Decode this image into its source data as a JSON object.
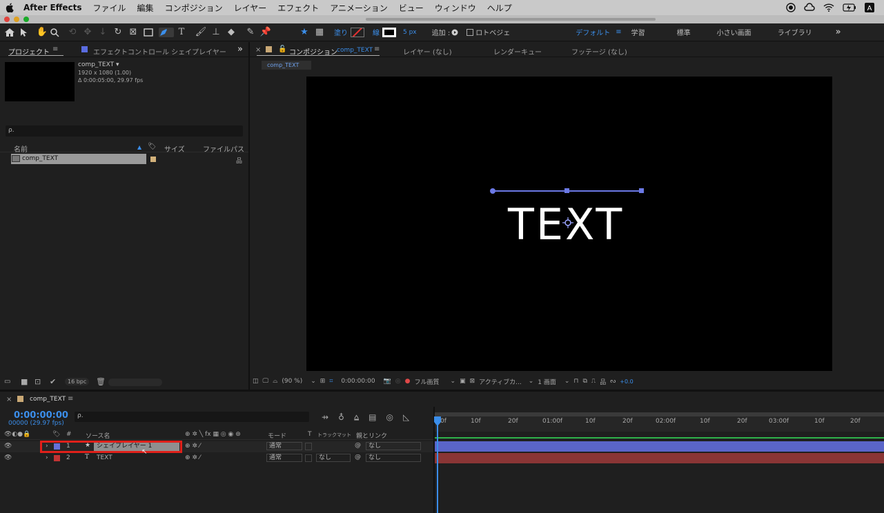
{
  "menubar": {
    "apple": "",
    "app_name": "After Effects",
    "items": [
      "ファイル",
      "編集",
      "コンポジション",
      "レイヤー",
      "エフェクト",
      "アニメーション",
      "ビュー",
      "ウィンドウ",
      "ヘルプ"
    ]
  },
  "toolbar": {
    "fill_label": "塗り",
    "stroke_label": "線",
    "stroke_width": "5 px",
    "add_label": "追加 :",
    "rotobezier_label": "ロトベジェ",
    "workspaces": [
      "デフォルト",
      "学習",
      "標準",
      "小さい画面",
      "ライブラリ"
    ],
    "more": "»"
  },
  "project_panel": {
    "tab_project": "プロジェクト",
    "tab_effects": "エフェクトコントロール シェイプレイヤー",
    "more": "»",
    "comp_name": "comp_TEXT ▾",
    "comp_size": "1920 x 1080 (1.00)",
    "comp_duration": "Δ 0:00:05:00, 29.97 fps",
    "search_placeholder": "ρ.",
    "col_name": "名前",
    "col_size": "サイズ",
    "col_path": "ファイルパス",
    "item_name": "comp_TEXT",
    "bpc": "16 bpc"
  },
  "viewer": {
    "tab_comp_prefix": "コンポジション",
    "tab_comp_name": "comp_TEXT",
    "tab_layer": "レイヤー (なし)",
    "tab_render": "レンダーキュー",
    "tab_footage": "フッテージ (なし)",
    "comp_chip": "comp_TEXT",
    "canvas_text": "TEXT",
    "zoom": "(90 %)",
    "timecode": "0:00:00:00",
    "quality": "フル画質",
    "camera": "アクティブカ...",
    "views": "1 画面",
    "exposure": "+0.0"
  },
  "timeline": {
    "tab_name": "comp_TEXT",
    "timecode": "0:00:00:00",
    "frames": "00000 (29.97 fps)",
    "search_placeholder": "ρ.",
    "col_num": "#",
    "col_source": "ソース名",
    "col_mode": "モード",
    "col_t": "T",
    "col_trkmat": "トラックマット",
    "col_parent": "親とリンク",
    "ruler": [
      "0f",
      "10f",
      "20f",
      "01:00f",
      "10f",
      "20f",
      "02:00f",
      "10f",
      "20f",
      "03:00f",
      "10f",
      "20f"
    ],
    "layers": [
      {
        "num": "1",
        "icon": "★",
        "name": "シェイプレイヤー 1",
        "mode": "通常",
        "trkmat": "",
        "parent": "なし",
        "color": "#6670d8",
        "bar": "#5a65c9"
      },
      {
        "num": "2",
        "icon": "T",
        "name": "TEXT",
        "mode": "通常",
        "trkmat": "なし",
        "parent": "なし",
        "color": "#c23333",
        "bar": "#8a3535"
      }
    ]
  }
}
